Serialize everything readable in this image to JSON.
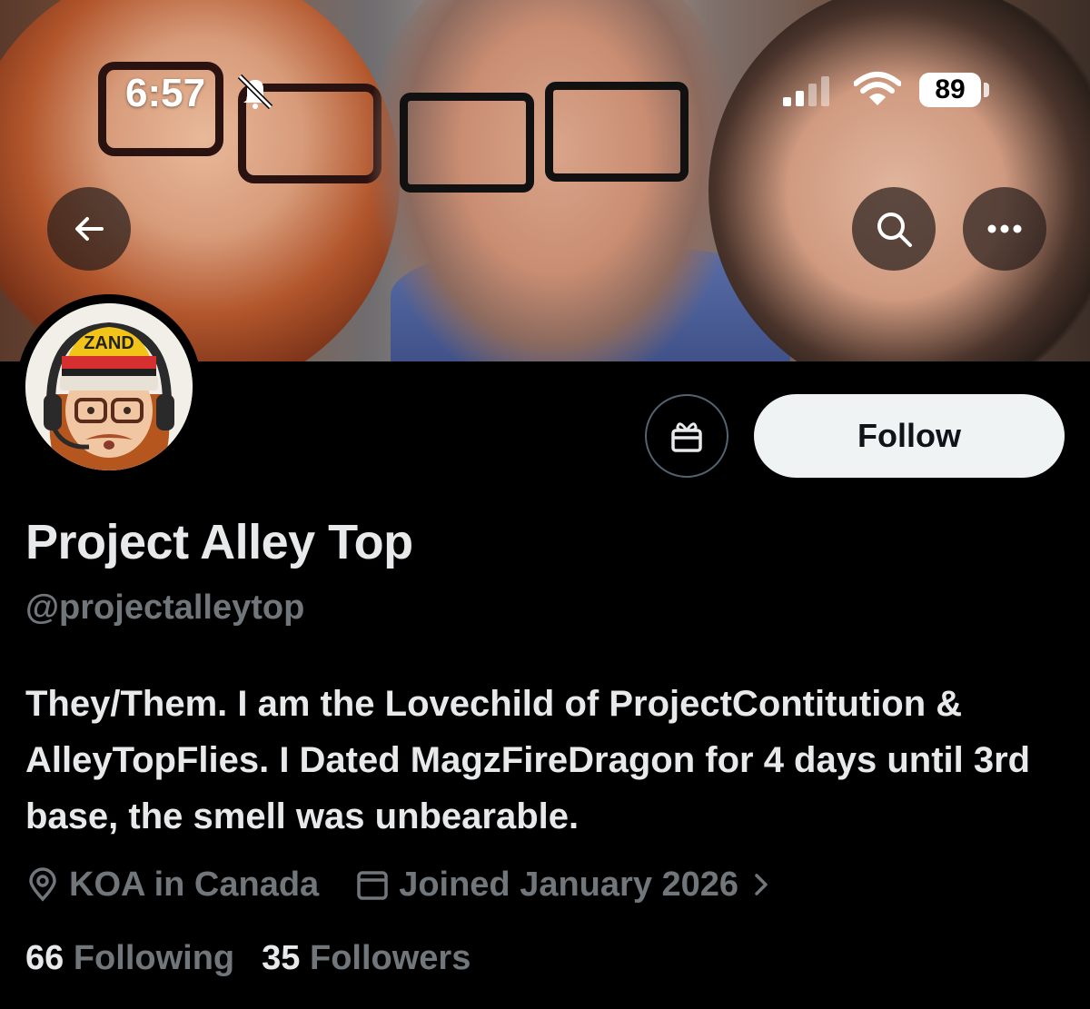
{
  "status_bar": {
    "time": "6:57",
    "battery": "89"
  },
  "header": {
    "back_icon": "arrow-left-icon",
    "search_icon": "search-icon",
    "more_icon": "ellipsis-icon"
  },
  "actions": {
    "gift_icon": "gift-icon",
    "follow_label": "Follow"
  },
  "avatar": {
    "hat_text": "ZAND"
  },
  "profile": {
    "display_name": "Project Alley Top",
    "handle": "@projectalleytop",
    "bio": "They/Them. I am the Lovechild of ProjectContitution & AlleyTopFlies. I Dated MagzFireDragon for 4 days until 3rd base, the smell was unbearable.",
    "location": "KOA in Canada",
    "joined": "Joined January 2026",
    "following_count": "66",
    "following_label": "Following",
    "followers_count": "35",
    "followers_label": "Followers"
  },
  "colors": {
    "background": "#000000",
    "primary_text": "#e7e9ea",
    "secondary_text": "#71767b",
    "follow_button_bg": "#eff3f4",
    "follow_button_text": "#0f1419"
  }
}
